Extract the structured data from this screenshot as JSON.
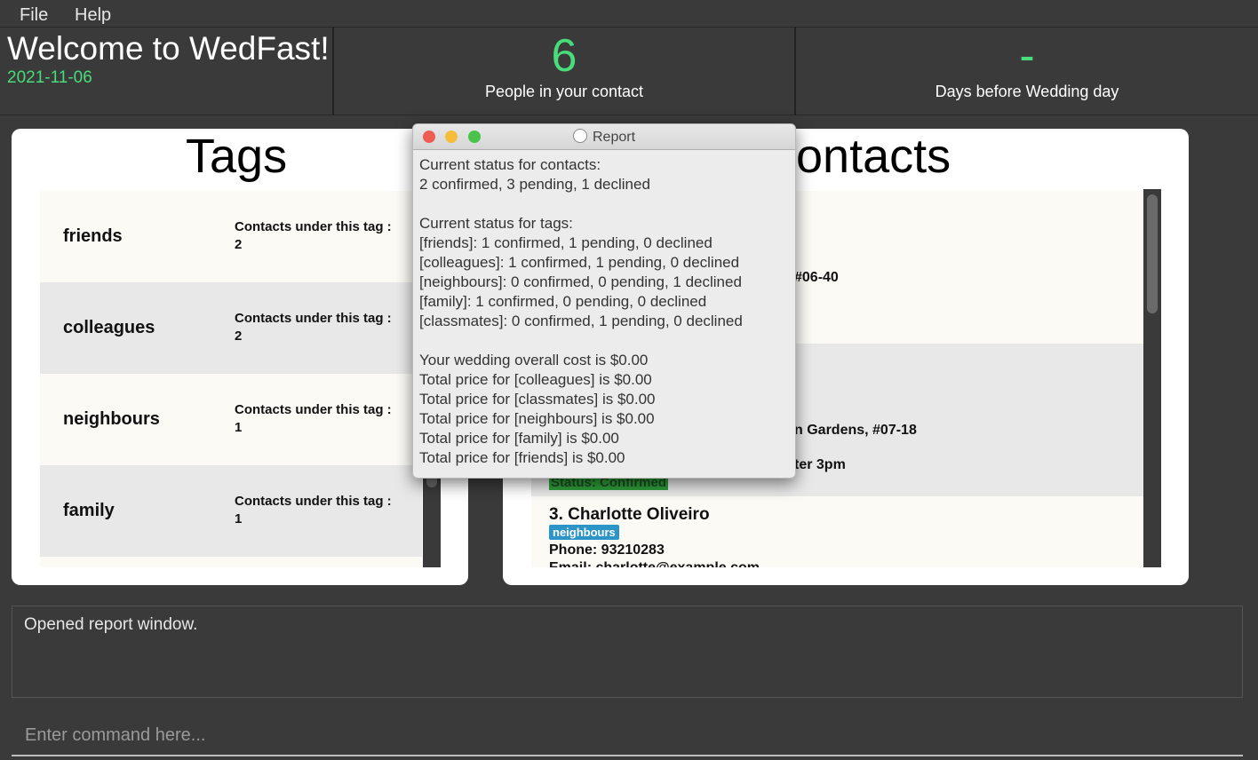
{
  "menu": {
    "file": "File",
    "help": "Help"
  },
  "header": {
    "welcome": "Welcome to WedFast!",
    "date": "2021-11-06",
    "people_count": "6",
    "people_label": "People in your contact",
    "days_value": "-",
    "days_label": "Days before Wedding day"
  },
  "tags_panel": {
    "title": "Tags",
    "count_label": "Contacts under this tag :",
    "items": [
      {
        "name": "friends",
        "count": "2"
      },
      {
        "name": "colleagues",
        "count": "2"
      },
      {
        "name": "neighbours",
        "count": "1"
      },
      {
        "name": "family",
        "count": "1"
      }
    ]
  },
  "contacts_panel": {
    "title_visible": "ontacts",
    "row1_fragment": "#06-40",
    "row2_address_fragment": "n Gardens, #07-18",
    "row2_note_fragment": "ter 3pm",
    "row2_status": "Status: Confirmed",
    "row3": {
      "index_name": "3.  Charlotte Oliveiro",
      "tag": "neighbours",
      "phone": "Phone: 93210283",
      "email": "Email: charlotte@example.com"
    }
  },
  "report": {
    "title": "Report",
    "lines": [
      "Current status for contacts:",
      "2 confirmed, 3 pending, 1 declined",
      "",
      "Current status for tags:",
      "[friends]: 1 confirmed, 1 pending, 0 declined",
      "[colleagues]: 1 confirmed, 1 pending, 0 declined",
      "[neighbours]: 0 confirmed, 0 pending, 1 declined",
      "[family]: 1 confirmed, 0 pending, 0 declined",
      "[classmates]: 0 confirmed, 1 pending, 0 declined",
      "",
      "Your wedding overall cost is $0.00",
      "Total price for [colleagues] is $0.00",
      "Total price for [classmates] is $0.00",
      "Total price for [neighbours] is $0.00",
      "Total price for [family] is $0.00",
      "Total price for [friends] is $0.00"
    ]
  },
  "result": {
    "text": "Opened report window."
  },
  "command": {
    "placeholder": "Enter command here..."
  },
  "colors": {
    "accent": "#48dc7b",
    "background": "#3a3a3a",
    "status_confirmed": "#2e9c3a",
    "tag_chip": "#2d94c8"
  }
}
